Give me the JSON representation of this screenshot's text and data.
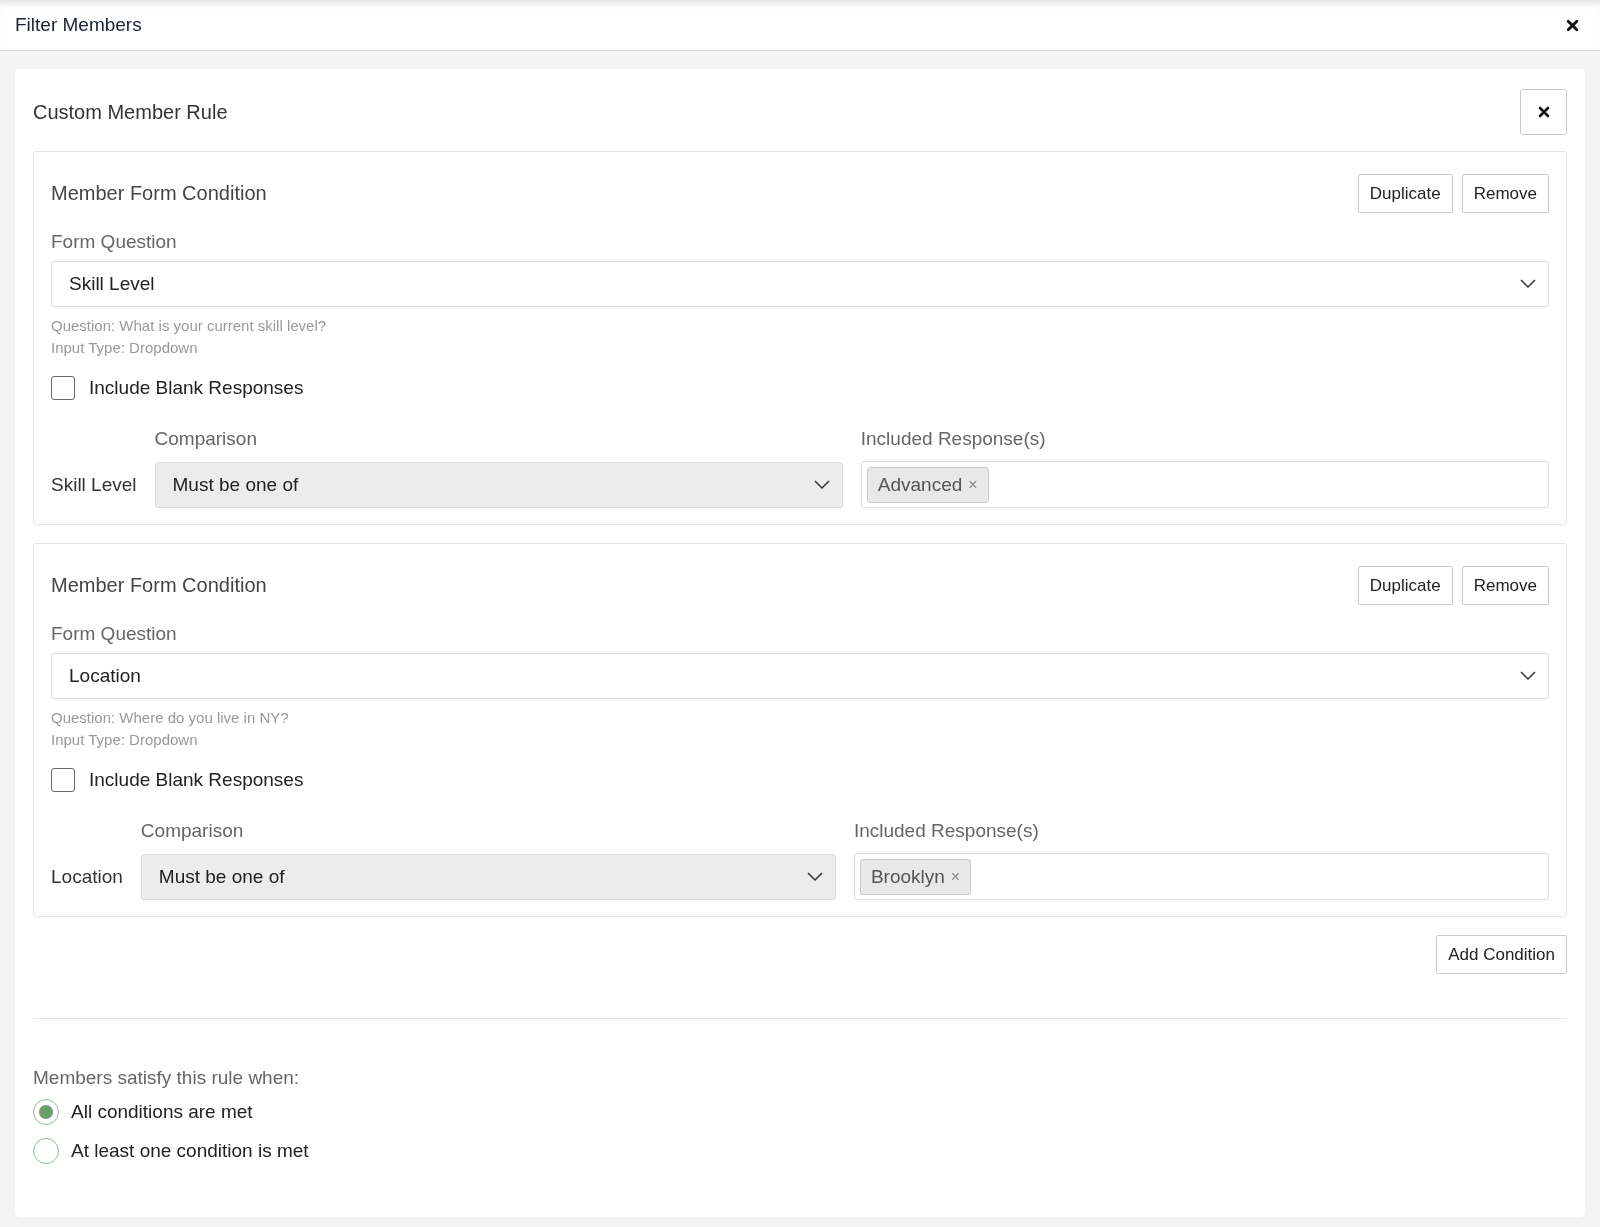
{
  "dialog": {
    "title": "Filter Members"
  },
  "rule": {
    "title": "Custom Member Rule",
    "conditions": [
      {
        "title": "Member Form Condition",
        "buttons": [
          "Duplicate",
          "Remove"
        ],
        "question_label": "Form Question",
        "question": "Skill Level",
        "hint_question": "Question: What is your current skill level?",
        "hint_type": "Input Type: Dropdown",
        "include_blank": {
          "label": "Include Blank Responses",
          "checked": false
        },
        "row_label": "Skill Level",
        "comparison_label": "Comparison",
        "comparison": "Must be one of",
        "responses_label": "Included Response(s)",
        "responses": [
          {
            "label": "Advanced",
            "remove": "×"
          }
        ]
      },
      {
        "title": "Member Form Condition",
        "buttons": [
          "Duplicate",
          "Remove"
        ],
        "question_label": "Form Question",
        "question": "Location",
        "hint_question": "Question: Where do you live in NY?",
        "hint_type": "Input Type: Dropdown",
        "include_blank": {
          "label": "Include Blank Responses",
          "checked": false
        },
        "row_label": "Location",
        "comparison_label": "Comparison",
        "comparison": "Must be one of",
        "responses_label": "Included Response(s)",
        "responses": [
          {
            "label": "Brooklyn",
            "remove": "×"
          }
        ]
      }
    ],
    "add_button": "Add Condition",
    "satisfy_label": "Members satisfy this rule when:",
    "options": [
      {
        "label": "All conditions are met",
        "selected": true
      },
      {
        "label": "At least one condition is met",
        "selected": false
      }
    ]
  }
}
